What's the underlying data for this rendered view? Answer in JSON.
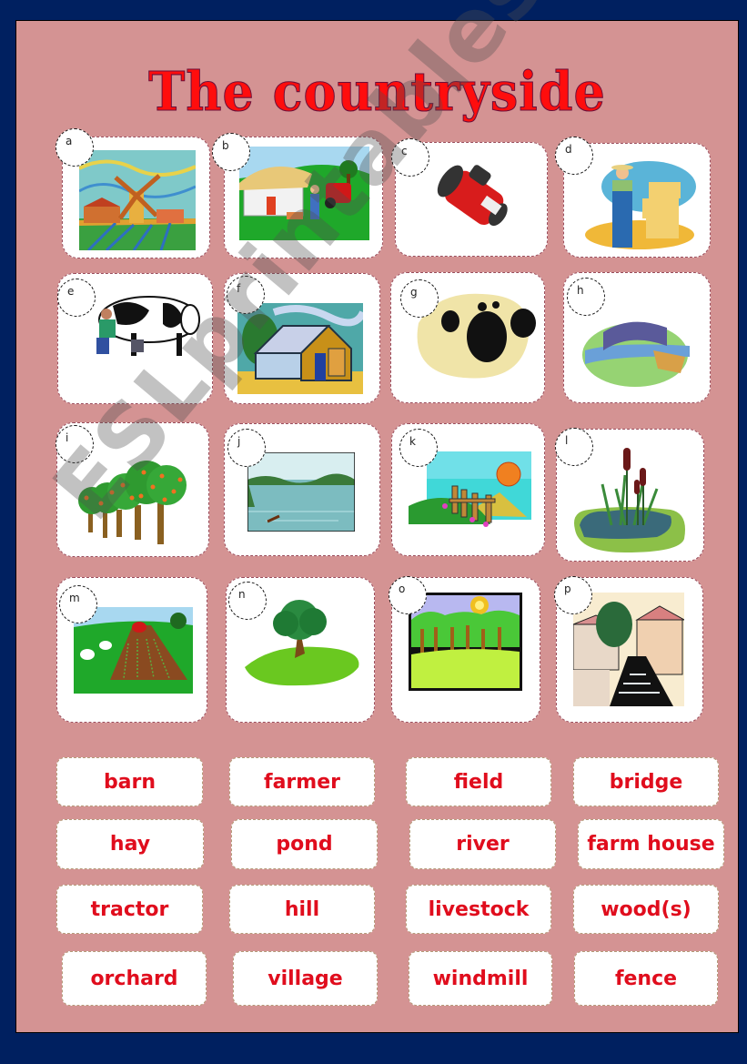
{
  "title": "The countryside",
  "watermark": "ESLprintables.com",
  "colors": {
    "background": "#002060",
    "panel": "#d49393",
    "title": "#ff0d0d",
    "word_text": "#e00d1d"
  },
  "picture_cards": [
    {
      "letter": "a",
      "depicts": "windmill"
    },
    {
      "letter": "b",
      "depicts": "farm house"
    },
    {
      "letter": "c",
      "depicts": "tractor"
    },
    {
      "letter": "d",
      "depicts": "farmer with hay"
    },
    {
      "letter": "e",
      "depicts": "livestock (cow being milked)"
    },
    {
      "letter": "f",
      "depicts": "barn"
    },
    {
      "letter": "g",
      "depicts": "hay"
    },
    {
      "letter": "h",
      "depicts": "bridge"
    },
    {
      "letter": "i",
      "depicts": "orchard"
    },
    {
      "letter": "j",
      "depicts": "river"
    },
    {
      "letter": "k",
      "depicts": "fence"
    },
    {
      "letter": "l",
      "depicts": "pond"
    },
    {
      "letter": "m",
      "depicts": "field"
    },
    {
      "letter": "n",
      "depicts": "hill"
    },
    {
      "letter": "o",
      "depicts": "wood(s)"
    },
    {
      "letter": "p",
      "depicts": "village"
    }
  ],
  "word_cards": [
    "barn",
    "farmer",
    "field",
    "bridge",
    "hay",
    "pond",
    "river",
    "farm house",
    "tractor",
    "hill",
    "livestock",
    "wood(s)",
    "orchard",
    "village",
    "windmill",
    "fence"
  ]
}
